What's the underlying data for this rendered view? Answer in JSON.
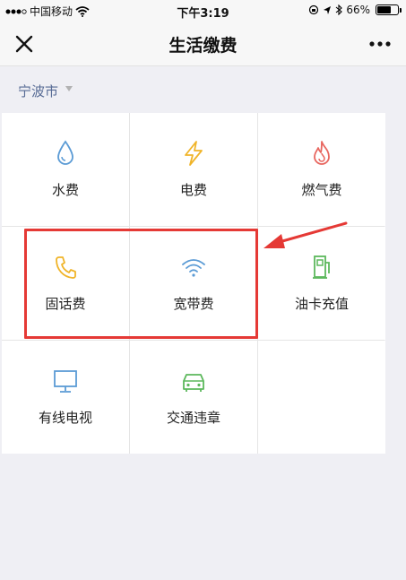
{
  "status_bar": {
    "carrier": "中国移动",
    "time": "下午3:19",
    "battery": "66%",
    "battery_level": 0.66
  },
  "nav": {
    "title": "生活缴费"
  },
  "city": {
    "name": "宁波市"
  },
  "services": [
    {
      "label": "水费",
      "icon": "water-drop-icon",
      "color": "#5b9bd5"
    },
    {
      "label": "电费",
      "icon": "lightning-icon",
      "color": "#f0b429"
    },
    {
      "label": "燃气费",
      "icon": "flame-icon",
      "color": "#e8665f"
    },
    {
      "label": "固话费",
      "icon": "telephone-icon",
      "color": "#f0b429"
    },
    {
      "label": "宽带费",
      "icon": "wifi-icon",
      "color": "#5b9bd5"
    },
    {
      "label": "油卡充值",
      "icon": "fuel-pump-icon",
      "color": "#5cb85c"
    },
    {
      "label": "有线电视",
      "icon": "tv-monitor-icon",
      "color": "#5b9bd5"
    },
    {
      "label": "交通违章",
      "icon": "car-icon",
      "color": "#5cb85c"
    }
  ],
  "colors": {
    "highlight": "#e53935",
    "link": "#576b95"
  }
}
